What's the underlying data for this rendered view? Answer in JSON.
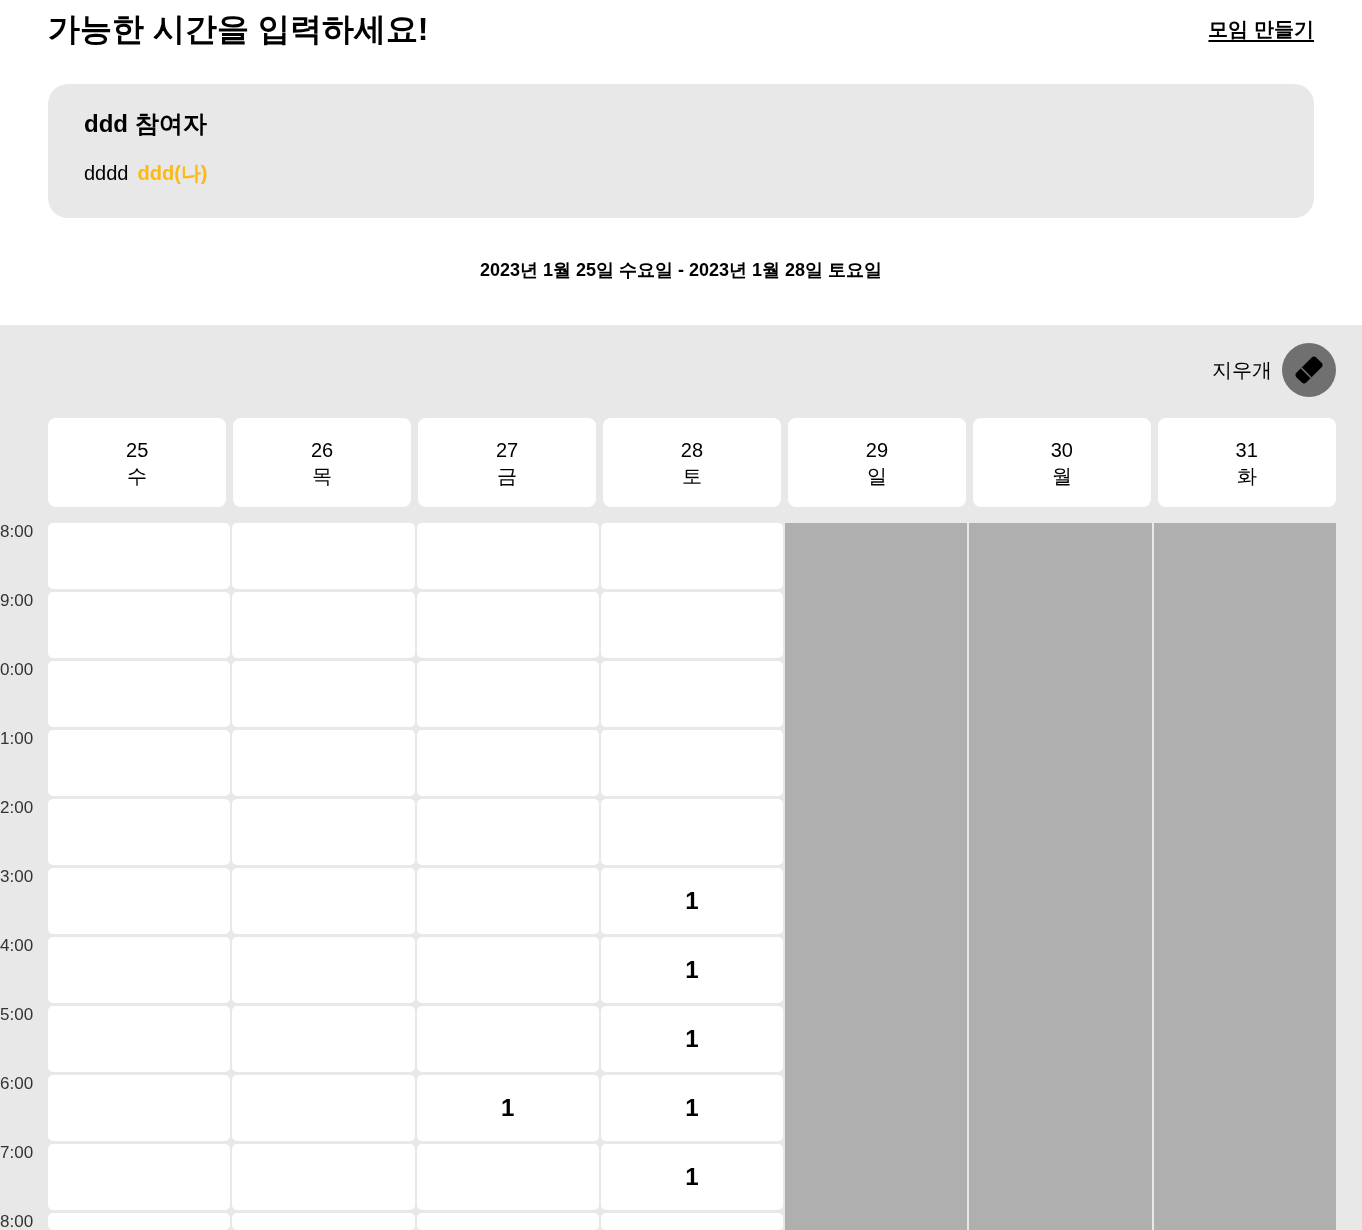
{
  "header": {
    "title": "가능한 시간을 입력하세요!",
    "create_link": "모임 만들기"
  },
  "participants": {
    "title": "ddd 참여자",
    "people": [
      {
        "name": "dddd",
        "is_me": false
      },
      {
        "name": "ddd(나)",
        "is_me": true
      }
    ]
  },
  "date_range": "2023년 1월 25일 수요일 - 2023년 1월 28일 토요일",
  "eraser": {
    "label": "지우개"
  },
  "days": [
    {
      "date": "25",
      "weekday": "수",
      "disabled": false
    },
    {
      "date": "26",
      "weekday": "목",
      "disabled": false
    },
    {
      "date": "27",
      "weekday": "금",
      "disabled": false
    },
    {
      "date": "28",
      "weekday": "토",
      "disabled": false
    },
    {
      "date": "29",
      "weekday": "일",
      "disabled": true
    },
    {
      "date": "30",
      "weekday": "월",
      "disabled": true
    },
    {
      "date": "31",
      "weekday": "화",
      "disabled": true
    }
  ],
  "time_rows": [
    {
      "time": "8:00",
      "cells": [
        {},
        {},
        {},
        {}
      ]
    },
    {
      "time": "9:00",
      "cells": [
        {},
        {},
        {},
        {}
      ]
    },
    {
      "time": "0:00",
      "cells": [
        {},
        {},
        {},
        {}
      ]
    },
    {
      "time": "1:00",
      "cells": [
        {},
        {},
        {},
        {}
      ]
    },
    {
      "time": "2:00",
      "cells": [
        {},
        {},
        {},
        {}
      ]
    },
    {
      "time": "3:00",
      "cells": [
        {},
        {},
        {},
        {
          "count": "1"
        }
      ]
    },
    {
      "time": "4:00",
      "cells": [
        {},
        {},
        {},
        {
          "count": "1"
        }
      ]
    },
    {
      "time": "5:00",
      "cells": [
        {},
        {},
        {},
        {
          "count": "1"
        }
      ]
    },
    {
      "time": "6:00",
      "cells": [
        {},
        {},
        {
          "count": "1"
        },
        {
          "count": "1"
        }
      ]
    },
    {
      "time": "7:00",
      "cells": [
        {},
        {},
        {},
        {
          "count": "1"
        }
      ]
    },
    {
      "time": "8:00",
      "cells": [
        {},
        {},
        {},
        {}
      ]
    }
  ]
}
